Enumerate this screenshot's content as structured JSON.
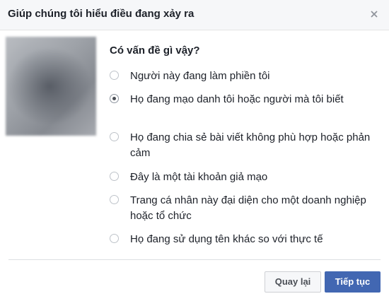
{
  "dialog": {
    "title": "Giúp chúng tôi hiểu điều đang xảy ra",
    "close_icon": "close-icon"
  },
  "question": "Có vấn đề gì vậy?",
  "options": [
    {
      "label": "Người này đang làm phiền tôi",
      "selected": false
    },
    {
      "label": "Họ đang mạo danh tôi hoặc người mà tôi biết",
      "selected": true
    },
    {
      "label": "Họ đang chia sẻ bài viết không phù hợp hoặc phản cảm",
      "selected": false
    },
    {
      "label": "Đây là một tài khoản giả mạo",
      "selected": false
    },
    {
      "label": "Trang cá nhân này đại diện cho một doanh nghiệp hoặc tổ chức",
      "selected": false
    },
    {
      "label": "Họ đang sử dụng tên khác so với thực tế",
      "selected": false
    }
  ],
  "footer": {
    "back_label": "Quay lại",
    "continue_label": "Tiếp tục"
  },
  "colors": {
    "primary": "#4267b2",
    "header_bg": "#f6f7f9",
    "text": "#1d2129"
  }
}
